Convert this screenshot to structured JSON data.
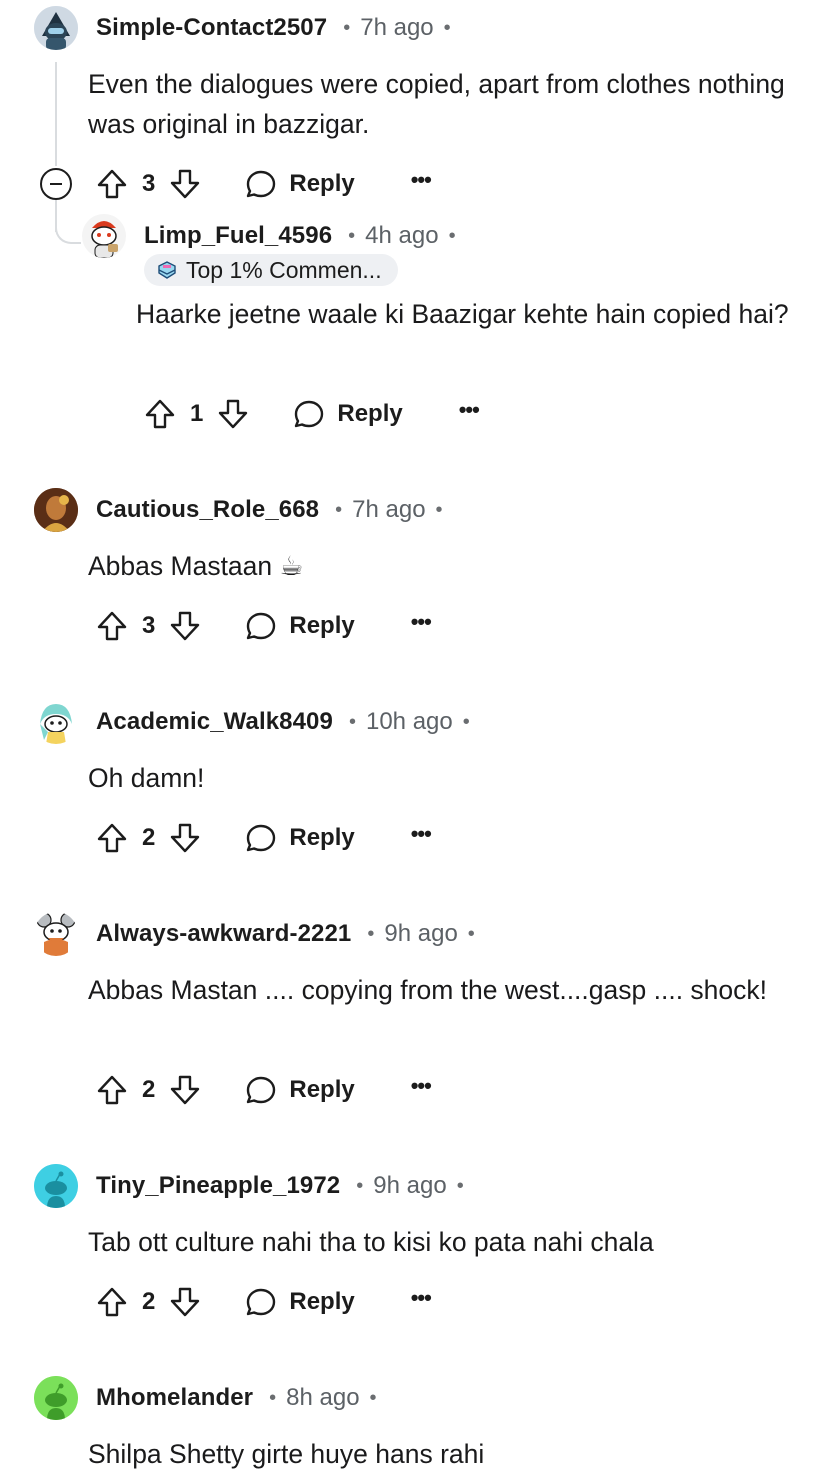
{
  "comments": [
    {
      "username": "Simple-Contact2507",
      "time": "7h ago",
      "body": "Even the dialogues were copied, apart from clothes nothing was original in bazzigar.",
      "score": "3",
      "reply_label": "Reply",
      "avatar_icon": "snoo-dark-helmet-avatar"
    },
    {
      "username": "Limp_Fuel_4596",
      "time": "4h ago",
      "badge": "Top 1% Commen...",
      "body": "Haarke jeetne waale ki Baazigar kehte hain copied hai?",
      "score": "1",
      "reply_label": "Reply",
      "avatar_icon": "snoo-red-hair-avatar"
    },
    {
      "username": "Cautious_Role_668",
      "time": "7h ago",
      "body": "Abbas Mastaan ☕",
      "score": "3",
      "reply_label": "Reply",
      "avatar_icon": "photo-avatar"
    },
    {
      "username": "Academic_Walk8409",
      "time": "10h ago",
      "body": "Oh damn!",
      "score": "2",
      "reply_label": "Reply",
      "avatar_icon": "snoo-teal-hair-avatar"
    },
    {
      "username": "Always-awkward-2221",
      "time": "9h ago",
      "body": "Abbas Mastan .... copying from the west....gasp .... shock!",
      "score": "2",
      "reply_label": "Reply",
      "avatar_icon": "snoo-mouse-ears-avatar"
    },
    {
      "username": "Tiny_Pineapple_1972",
      "time": "9h ago",
      "body": "Tab ott culture nahi tha to kisi ko pata nahi chala",
      "score": "2",
      "reply_label": "Reply",
      "avatar_icon": "snoo-default-cyan-avatar"
    },
    {
      "username": "Mhomelander",
      "time": "8h ago",
      "body": "Shilpa Shetty girte huye hans rahi",
      "avatar_icon": "snoo-default-green-avatar"
    }
  ],
  "more_label": "•••",
  "colors": {
    "text": "#1c1c1c",
    "muted": "#5c6166",
    "thread_line": "#d9dcdf",
    "badge_bg": "#eef0f3"
  }
}
